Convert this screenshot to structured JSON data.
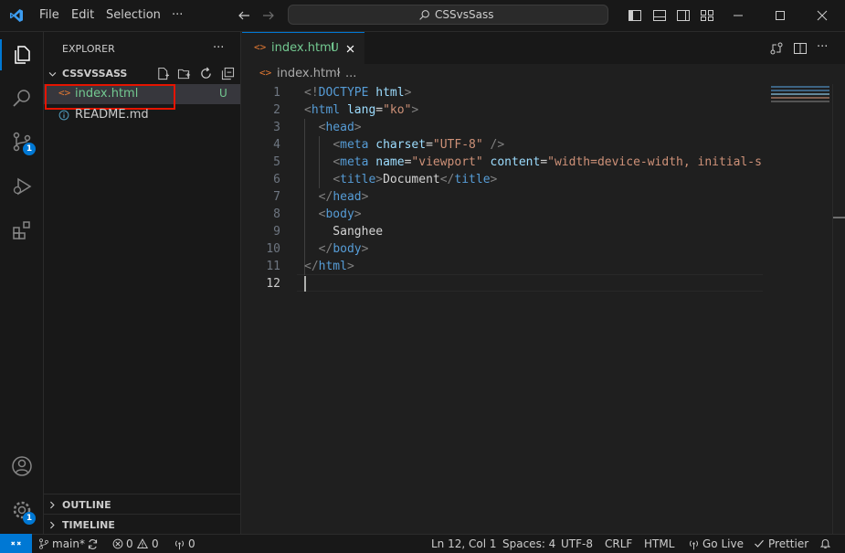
{
  "titlebar": {
    "menus": [
      "File",
      "Edit",
      "Selection",
      "···"
    ],
    "search_text": "CSSvsSass"
  },
  "activity": {
    "scm_badge": "1",
    "settings_badge": "1"
  },
  "sidebar": {
    "title": "EXPLORER",
    "more": "···",
    "folder": "CSSVSSASS",
    "files": [
      {
        "name": "index.html",
        "status": "U",
        "icon": "html-icon"
      },
      {
        "name": "README.md",
        "status": "",
        "icon": "info-icon"
      }
    ],
    "outline": "OUTLINE",
    "timeline": "TIMELINE"
  },
  "editor": {
    "tab_label": "index.html",
    "tab_status": "U",
    "breadcrumb_file": "index.html",
    "breadcrumb_rest": "...",
    "line_numbers": [
      "1",
      "2",
      "3",
      "4",
      "5",
      "6",
      "7",
      "8",
      "9",
      "10",
      "11",
      "12"
    ],
    "lines": [
      [
        [
          "t-punc",
          "<!"
        ],
        [
          "t-tag",
          "DOCTYPE"
        ],
        [
          "t-text",
          " "
        ],
        [
          "t-attr",
          "html"
        ],
        [
          "t-punc",
          ">"
        ]
      ],
      [
        [
          "t-punc",
          "<"
        ],
        [
          "t-tag",
          "html"
        ],
        [
          "t-text",
          " "
        ],
        [
          "t-attr",
          "lang"
        ],
        [
          "t-text",
          "="
        ],
        [
          "t-str",
          "\"ko\""
        ],
        [
          "t-punc",
          ">"
        ]
      ],
      [
        [
          "t-text",
          "  "
        ],
        [
          "t-punc",
          "<"
        ],
        [
          "t-tag",
          "head"
        ],
        [
          "t-punc",
          ">"
        ]
      ],
      [
        [
          "t-text",
          "    "
        ],
        [
          "t-punc",
          "<"
        ],
        [
          "t-tag",
          "meta"
        ],
        [
          "t-text",
          " "
        ],
        [
          "t-attr",
          "charset"
        ],
        [
          "t-text",
          "="
        ],
        [
          "t-str",
          "\"UTF-8\""
        ],
        [
          "t-text",
          " "
        ],
        [
          "t-punc",
          "/>"
        ]
      ],
      [
        [
          "t-text",
          "    "
        ],
        [
          "t-punc",
          "<"
        ],
        [
          "t-tag",
          "meta"
        ],
        [
          "t-text",
          " "
        ],
        [
          "t-attr",
          "name"
        ],
        [
          "t-text",
          "="
        ],
        [
          "t-str",
          "\"viewport\""
        ],
        [
          "t-text",
          " "
        ],
        [
          "t-attr",
          "content"
        ],
        [
          "t-text",
          "="
        ],
        [
          "t-str",
          "\"width=device-width, initial-sca"
        ]
      ],
      [
        [
          "t-text",
          "    "
        ],
        [
          "t-punc",
          "<"
        ],
        [
          "t-tag",
          "title"
        ],
        [
          "t-punc",
          ">"
        ],
        [
          "t-text",
          "Document"
        ],
        [
          "t-punc",
          "</"
        ],
        [
          "t-tag",
          "title"
        ],
        [
          "t-punc",
          ">"
        ]
      ],
      [
        [
          "t-text",
          "  "
        ],
        [
          "t-punc",
          "</"
        ],
        [
          "t-tag",
          "head"
        ],
        [
          "t-punc",
          ">"
        ]
      ],
      [
        [
          "t-text",
          "  "
        ],
        [
          "t-punc",
          "<"
        ],
        [
          "t-tag",
          "body"
        ],
        [
          "t-punc",
          ">"
        ]
      ],
      [
        [
          "t-text",
          "    Sanghee"
        ]
      ],
      [
        [
          "t-text",
          "  "
        ],
        [
          "t-punc",
          "</"
        ],
        [
          "t-tag",
          "body"
        ],
        [
          "t-punc",
          ">"
        ]
      ],
      [
        [
          "t-punc",
          "</"
        ],
        [
          "t-tag",
          "html"
        ],
        [
          "t-punc",
          ">"
        ]
      ],
      [
        [
          "t-text",
          ""
        ]
      ]
    ]
  },
  "statusbar": {
    "branch": "main*",
    "errors": "0",
    "warnings": "0",
    "ports": "0",
    "position": "Ln 12, Col 1",
    "spaces": "Spaces: 4",
    "encoding": "UTF-8",
    "eol": "CRLF",
    "language": "HTML",
    "golive": "Go Live",
    "prettier": "Prettier"
  },
  "colors": {
    "accent": "#0078d4",
    "untracked": "#73c991",
    "highlight_box": "#e51400"
  }
}
